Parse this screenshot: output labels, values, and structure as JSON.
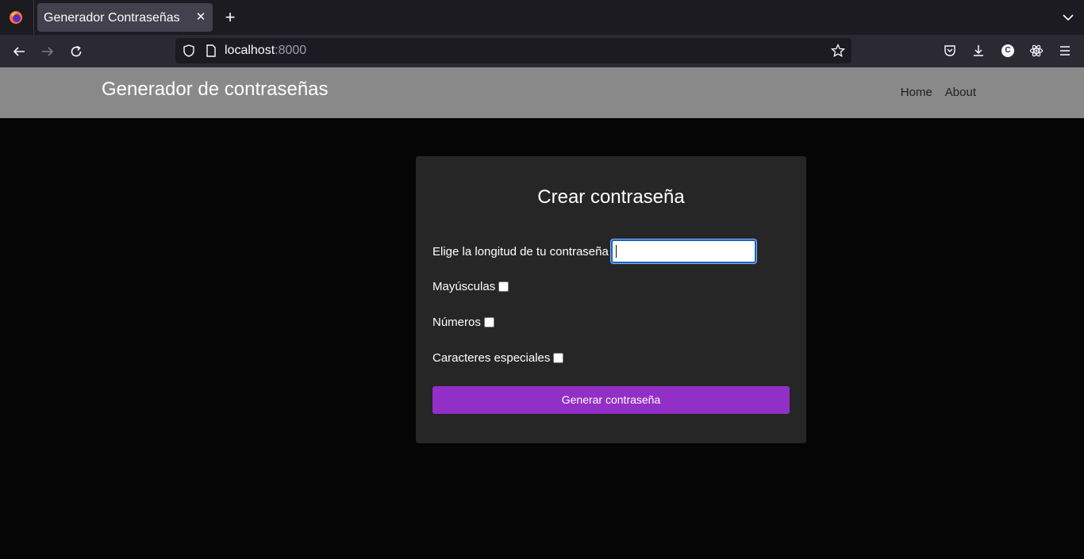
{
  "browser": {
    "tab_title": "Generador Contraseñas",
    "url_host": "localhost",
    "url_port": ":8000",
    "icons": [
      "firefox-logo-icon",
      "close-icon",
      "plus-icon",
      "chevron-down-icon",
      "back-arrow-icon",
      "forward-arrow-icon",
      "reload-icon",
      "shield-icon",
      "page-icon",
      "star-icon",
      "pocket-icon",
      "download-icon",
      "account-icon",
      "react-devtools-icon",
      "hamburger-menu-icon"
    ],
    "account_initial": "C"
  },
  "header": {
    "brand": "Generador de contraseñas",
    "nav": [
      "Home",
      "About"
    ]
  },
  "form": {
    "title": "Crear contraseña",
    "length_label": "Elige la longitud de tu contraseña",
    "length_value": "",
    "options": [
      {
        "label": "Mayúsculas",
        "checked": false
      },
      {
        "label": "Números",
        "checked": false
      },
      {
        "label": "Caracteres especiales",
        "checked": false
      }
    ],
    "submit_label": "Generar contraseña"
  },
  "colors": {
    "header_bg": "#898989",
    "page_bg": "#050505",
    "card_bg": "#262626",
    "button_bg": "#912fc6",
    "input_focus": "#1565c0"
  }
}
